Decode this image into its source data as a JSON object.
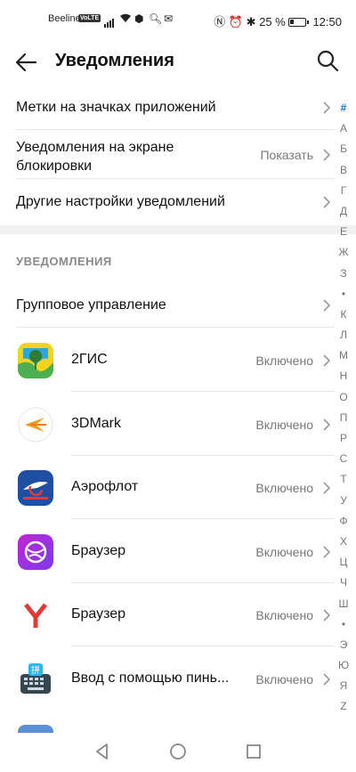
{
  "status_bar": {
    "carrier": "Beeline",
    "volte": "VoLTE",
    "battery_percent": "25 %",
    "time": "12:50"
  },
  "header": {
    "title": "Уведомления"
  },
  "settings": [
    {
      "label": "Метки на значках приложений",
      "value": ""
    },
    {
      "label": "Уведомления на экране блокировки",
      "label_line1": "Уведомления на экране",
      "label_line2": "блокировки",
      "value": "Показать"
    },
    {
      "label": "Другие настройки уведомлений",
      "value": ""
    }
  ],
  "section": {
    "title": "УВЕДОМЛЕНИЯ",
    "group_label": "Групповое управление"
  },
  "apps": [
    {
      "name": "2ГИС",
      "status": "Включено",
      "icon": "2gis-icon"
    },
    {
      "name": "3DMark",
      "status": "Включено",
      "icon": "3dmark-icon"
    },
    {
      "name": "Аэрофлот",
      "status": "Включено",
      "icon": "aeroflot-icon"
    },
    {
      "name": "Браузер",
      "status": "Включено",
      "icon": "huawei-browser-icon"
    },
    {
      "name": "Браузер",
      "status": "Включено",
      "icon": "yandex-browser-icon"
    },
    {
      "name": "Ввод с помощью пинь...",
      "status": "Включено",
      "icon": "pinyin-keyboard-icon"
    }
  ],
  "alphabet_index": [
    "#",
    "А",
    "Б",
    "В",
    "Г",
    "Д",
    "Е",
    "Ж",
    "З",
    "•",
    "К",
    "Л",
    "М",
    "Н",
    "О",
    "П",
    "Р",
    "С",
    "Т",
    "У",
    "Ф",
    "Х",
    "Ц",
    "Ч",
    "Ш",
    "•",
    "Э",
    "Ю",
    "Я",
    "Z"
  ],
  "colors": {
    "accent": "#1976d2",
    "text_secondary": "#777777"
  }
}
